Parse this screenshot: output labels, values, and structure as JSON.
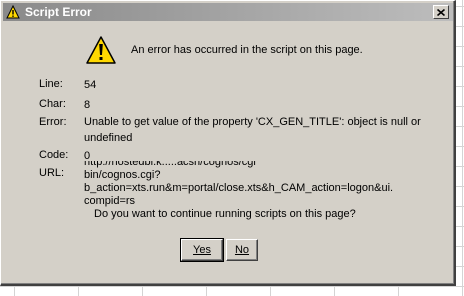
{
  "window": {
    "title": "Script Error",
    "close_icon": "close-icon"
  },
  "message": "An error has occurred in the script on this page.",
  "fields": {
    "line_label": "Line:",
    "line_value": "54",
    "char_label": "Char:",
    "char_value": "8",
    "error_label": "Error:",
    "error_value": "Unable to get value of the property 'CX_GEN_TITLE': object is null or undefined",
    "code_label": "Code:",
    "code_value": "0",
    "url_label": "URL:",
    "url_line1": "http://hostedbi.k.....acsn/cognos/cgi",
    "url_line2": "bin/cognos.cgi?",
    "url_line3": "b_action=xts.run&m=portal/close.xts&h_CAM_action=logon&ui.",
    "url_line4": "compid=rs"
  },
  "question": "Do you want to continue running scripts on this page?",
  "buttons": {
    "yes_label": "Yes",
    "no_label": "No"
  },
  "colors": {
    "dialog_bg": "#d4d0c8",
    "titlebar_start": "#8a8a8a",
    "titlebar_end": "#bdbdbd",
    "warning_yellow": "#ffd800"
  }
}
